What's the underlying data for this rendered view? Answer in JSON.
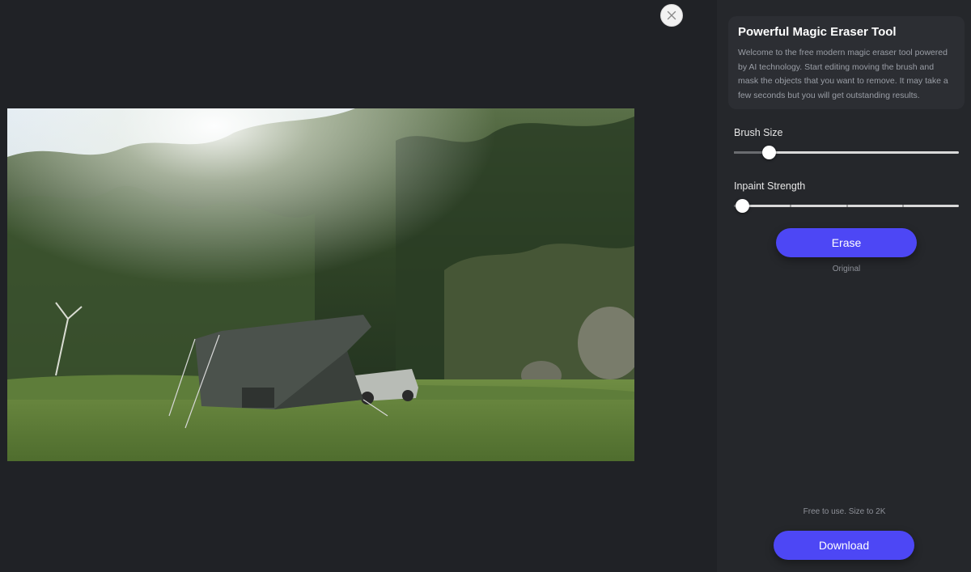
{
  "workspace": {
    "photo_alt": "Camping scene with tent and car in forest"
  },
  "panel": {
    "title": "Powerful Magic Eraser Tool",
    "description": "Welcome to the free modern magic eraser tool powered by AI technology. Start editing moving the brush and mask the objects that you want to remove. It may take a few seconds but you will get outstanding results."
  },
  "controls": {
    "brush_size": {
      "label": "Brush Size",
      "value_fraction": 0.12
    },
    "inpaint_strength": {
      "label": "Inpaint Strength",
      "value_fraction": 0.0
    }
  },
  "actions": {
    "erase_label": "Erase",
    "original_label": "Original",
    "footer_note": "Free to use. Size to 2K",
    "download_label": "Download"
  },
  "colors": {
    "accent": "#4d47f5",
    "background": "#202226",
    "sidebar": "#25272b"
  },
  "icons": {
    "close": "close-icon"
  }
}
